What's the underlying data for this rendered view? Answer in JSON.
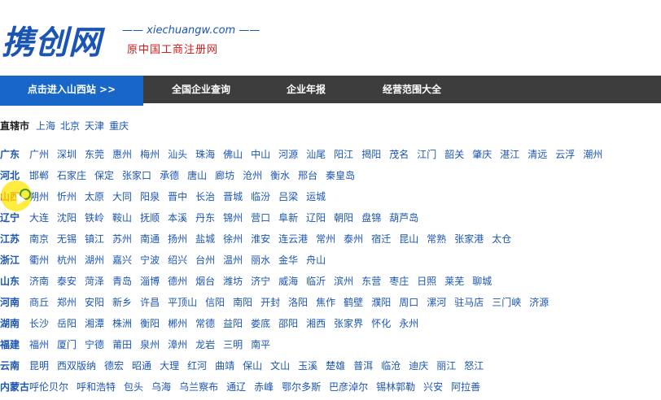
{
  "header": {
    "logo_text": "携创网",
    "url_text": "xiechuangw.com",
    "slogan": "原中国工商注册网"
  },
  "nav": {
    "items": [
      {
        "label": "点击进入山西站 >>",
        "active": true
      },
      {
        "label": "全国企业查询"
      },
      {
        "label": "企业年报"
      },
      {
        "label": "经营范围大全"
      }
    ]
  },
  "direct": {
    "label": "直辖市",
    "cities": [
      "上海",
      "北京",
      "天津",
      "重庆"
    ]
  },
  "provinces": [
    {
      "name": "广东",
      "cities": [
        "广州",
        "深圳",
        "东莞",
        "惠州",
        "梅州",
        "汕头",
        "珠海",
        "佛山",
        "中山",
        "河源",
        "汕尾",
        "阳江",
        "揭阳",
        "茂名",
        "江门",
        "韶关",
        "肇庆",
        "湛江",
        "清远",
        "云浮",
        "潮州"
      ]
    },
    {
      "name": "河北",
      "cities": [
        "邯郸",
        "石家庄",
        "保定",
        "张家口",
        "承德",
        "唐山",
        "廊坊",
        "沧州",
        "衡水",
        "邢台",
        "秦皇岛"
      ]
    },
    {
      "name": "山西",
      "highlight": true,
      "cities": [
        "朔州",
        "忻州",
        "太原",
        "大同",
        "阳泉",
        "晋中",
        "长治",
        "晋城",
        "临汾",
        "吕梁",
        "运城"
      ]
    },
    {
      "name": "辽宁",
      "cities": [
        "大连",
        "沈阳",
        "铁岭",
        "鞍山",
        "抚顺",
        "本溪",
        "丹东",
        "锦州",
        "营口",
        "阜新",
        "辽阳",
        "朝阳",
        "盘锦",
        "葫芦岛"
      ]
    },
    {
      "name": "江苏",
      "cities": [
        "南京",
        "无锡",
        "镇江",
        "苏州",
        "南通",
        "扬州",
        "盐城",
        "徐州",
        "淮安",
        "连云港",
        "常州",
        "泰州",
        "宿迁",
        "昆山",
        "常熟",
        "张家港",
        "太仓"
      ]
    },
    {
      "name": "浙江",
      "cities": [
        "衢州",
        "杭州",
        "湖州",
        "嘉兴",
        "宁波",
        "绍兴",
        "台州",
        "温州",
        "丽水",
        "金华",
        "舟山"
      ]
    },
    {
      "name": "山东",
      "cities": [
        "济南",
        "泰安",
        "菏泽",
        "青岛",
        "淄博",
        "德州",
        "烟台",
        "潍坊",
        "济宁",
        "威海",
        "临沂",
        "滨州",
        "东营",
        "枣庄",
        "日照",
        "莱芜",
        "聊城"
      ]
    },
    {
      "name": "河南",
      "cities": [
        "商丘",
        "郑州",
        "安阳",
        "新乡",
        "许昌",
        "平顶山",
        "信阳",
        "南阳",
        "开封",
        "洛阳",
        "焦作",
        "鹤壁",
        "濮阳",
        "周口",
        "漯河",
        "驻马店",
        "三门峡",
        "济源"
      ]
    },
    {
      "name": "湖南",
      "cities": [
        "长沙",
        "岳阳",
        "湘潭",
        "株洲",
        "衡阳",
        "郴州",
        "常德",
        "益阳",
        "娄底",
        "邵阳",
        "湘西",
        "张家界",
        "怀化",
        "永州"
      ]
    },
    {
      "name": "福建",
      "cities": [
        "福州",
        "厦门",
        "宁德",
        "莆田",
        "泉州",
        "漳州",
        "龙岩",
        "三明",
        "南平"
      ]
    },
    {
      "name": "云南",
      "cities": [
        "昆明",
        "西双版纳",
        "德宏",
        "昭通",
        "大理",
        "红河",
        "曲靖",
        "保山",
        "文山",
        "玉溪",
        "楚雄",
        "普洱",
        "临沧",
        "迪庆",
        "丽江",
        "怒江"
      ]
    },
    {
      "name": "内蒙古",
      "cities": [
        "呼伦贝尔",
        "呼和浩特",
        "包头",
        "乌海",
        "乌兰察布",
        "通辽",
        "赤峰",
        "鄂尔多斯",
        "巴彦淖尔",
        "锡林郭勒",
        "兴安",
        "阿拉善"
      ]
    }
  ]
}
